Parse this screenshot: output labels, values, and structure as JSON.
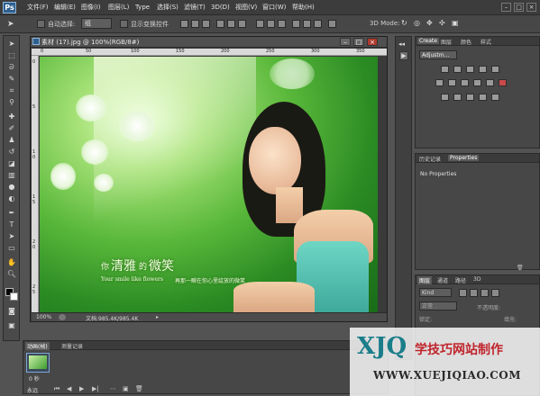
{
  "app": {
    "logo": "Ps"
  },
  "menu": [
    "文件(F)",
    "编辑(E)",
    "图像(I)",
    "图层(L)",
    "Type",
    "选择(S)",
    "滤镜(T)",
    "3D(D)",
    "视图(V)",
    "窗口(W)",
    "帮助(H)"
  ],
  "options_bar": {
    "auto_select_label": "自动选择:",
    "auto_select_value": "组",
    "transform_controls_label": "显示变换控件",
    "mode_3d_label": "3D Mode:"
  },
  "document": {
    "title": "素材 (17).jpg @ 100%(RGB/8#)",
    "zoom": "100%",
    "doc_size": "文档:985.4K/985.4K",
    "ruler_top_ticks": [
      "0",
      "50",
      "100",
      "150",
      "200",
      "250",
      "300",
      "350"
    ],
    "ruler_left_ticks": [
      "0",
      "5",
      "1 0",
      "1 5",
      "2 0",
      "2 5"
    ],
    "overlay_cn_1": "你",
    "overlay_cn_2": "清雅",
    "overlay_cn_3": "的",
    "overlay_cn_4": "微笑",
    "overlay_en": "Your smile like flowers",
    "overlay_small": "再那一瞬在你心里绽放的微笑"
  },
  "adjustments_panel": {
    "tabs": [
      "Create",
      "图层",
      "颜色",
      "样式"
    ],
    "dropdown": "Adjustm..."
  },
  "history_panel": {
    "tabs": [
      "历史记录",
      "Properties"
    ],
    "body": "No Properties"
  },
  "layers_panel": {
    "tabs": [
      "图层",
      "通道",
      "路径",
      "3D"
    ],
    "kind_label": "Kind",
    "blend_mode": "正常",
    "opacity_label": "不透明度:",
    "fill_label": "填充:",
    "lock_label": "锁定:"
  },
  "animation_panel": {
    "tabs": [
      "动画(帧)",
      "测量记录"
    ],
    "frame_time": "0 秒",
    "loop": "永远"
  },
  "watermark": {
    "xjq": "XJQ",
    "cn": "学技巧网站制作",
    "url": "WWW.XUEJIQIAO.COM"
  },
  "colors": {
    "ui_bg": "#535353",
    "menubar_bg": "#3c3c3c",
    "panel_bg": "#474747",
    "canvas_green": "#59b83a",
    "watermark_teal": "#1a7d8a",
    "watermark_red": "#c0242b"
  }
}
